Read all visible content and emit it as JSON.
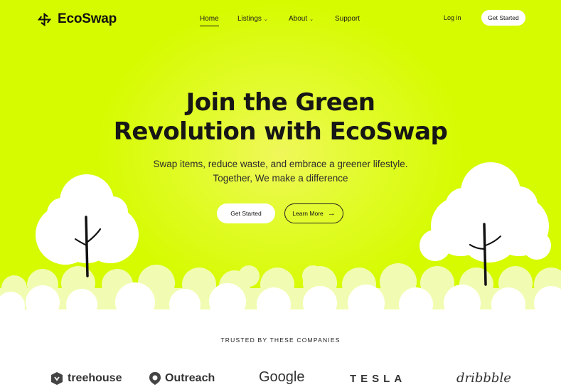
{
  "brand": {
    "name": "EcoSwap",
    "logo_icon": "pinwheel-icon"
  },
  "nav": {
    "home": "Home",
    "listings": "Listings",
    "about": "About",
    "support": "Support",
    "login": "Log in",
    "cta": "Get Started"
  },
  "hero": {
    "headline_line1": "Join the Green",
    "headline_line2": "Revolution with EcoSwap",
    "sub_line1": "Swap items, reduce waste, and embrace a greener lifestyle.",
    "sub_line2": "Together, We make a difference",
    "primary_button": "Get Started",
    "secondary_button": "Learn More"
  },
  "trusted": {
    "label": "TRUSTED BY THESE COMPANIES",
    "companies": [
      "treehouse",
      "Outreach",
      "Google",
      "TESLA",
      "dribbble"
    ]
  },
  "colors": {
    "accent": "#d6fb00",
    "cloud": "#f4fdb6",
    "text": "#161616"
  }
}
